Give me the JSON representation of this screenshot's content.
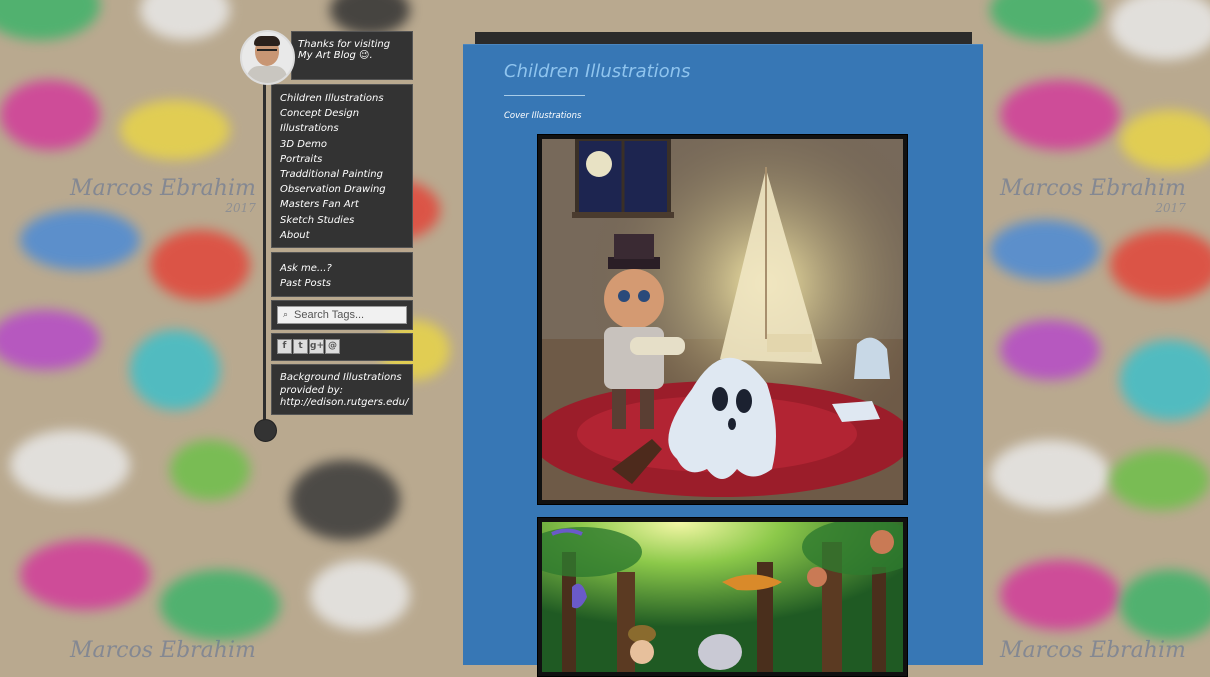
{
  "background": {
    "watermark_name": "Marcos Ebrahim",
    "watermark_year": "2017"
  },
  "sidebar": {
    "greeting": "Thanks for visiting My Art Blog 😉.",
    "nav": [
      {
        "label": "Children Illustrations"
      },
      {
        "label": "Concept Design"
      },
      {
        "label": "Illustrations"
      },
      {
        "label": "3D Demo"
      },
      {
        "label": "Portraits"
      },
      {
        "label": "Tradditional Painting"
      },
      {
        "label": "Observation Drawing"
      },
      {
        "label": "Masters Fan Art"
      },
      {
        "label": "Sketch Studies"
      },
      {
        "label": "About"
      }
    ],
    "links": [
      {
        "label": "Ask me...?"
      },
      {
        "label": "Past Posts"
      }
    ],
    "search": {
      "placeholder": "Search Tags...",
      "icon": "search-icon"
    },
    "social": [
      {
        "name": "facebook-icon",
        "glyph": "f"
      },
      {
        "name": "twitter-icon",
        "glyph": "t"
      },
      {
        "name": "google-plus-icon",
        "glyph": "g+"
      },
      {
        "name": "blog-icon",
        "glyph": "@"
      }
    ],
    "credit": "Background Illustrations provided by: http://edison.rutgers.edu/"
  },
  "post": {
    "title": "Children Illustrations",
    "caption": "Cover Illustrations"
  },
  "colors": {
    "page_bg": "#b9a98f",
    "panel": "#333333",
    "post_bg": "#3777b5",
    "title": "#8fc4ee"
  }
}
